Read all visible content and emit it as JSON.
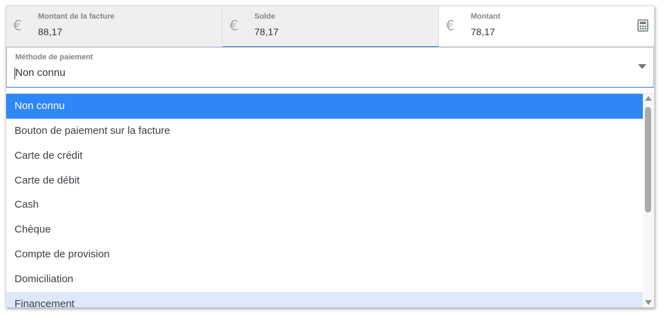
{
  "currency_symbol": "€",
  "amounts": [
    {
      "label": "Montant de la facture",
      "value": "88,17"
    },
    {
      "label": "Solde",
      "value": "78,17"
    },
    {
      "label": "Montant",
      "value": "78,17"
    }
  ],
  "payment_method": {
    "label": "Méthode de paiement",
    "value": "Non connu"
  },
  "options": [
    {
      "label": "Non connu",
      "state": "selected"
    },
    {
      "label": "Bouton de paiement sur la facture",
      "state": "normal"
    },
    {
      "label": "Carte de crédit",
      "state": "normal"
    },
    {
      "label": "Carte de débit",
      "state": "normal"
    },
    {
      "label": "Cash",
      "state": "normal"
    },
    {
      "label": "Chèque",
      "state": "normal"
    },
    {
      "label": "Compte de provision",
      "state": "normal"
    },
    {
      "label": "Domiciliation",
      "state": "normal"
    },
    {
      "label": "Financement",
      "state": "hover"
    }
  ],
  "colors": {
    "selected_bg": "#2f86f6",
    "hover_bg": "#dde9fb",
    "focus_border": "#2b7bd1"
  },
  "icons": {
    "calculator": "calculator-icon",
    "dropdown": "chevron-down-icon"
  }
}
